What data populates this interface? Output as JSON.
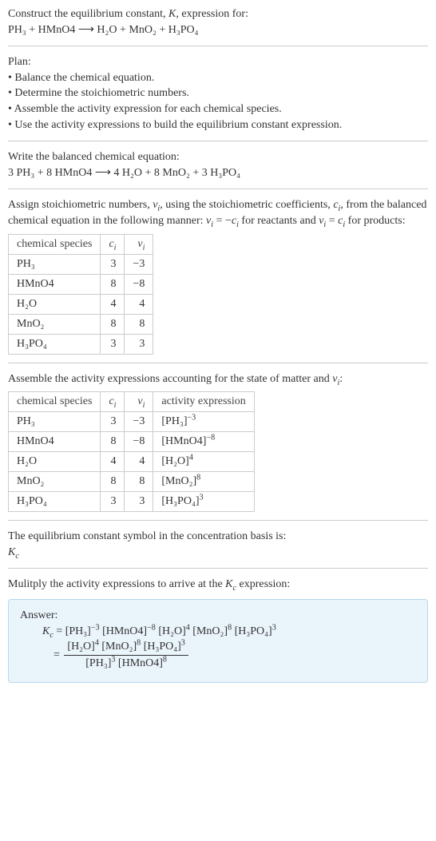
{
  "intro": {
    "line1": "Construct the equilibrium constant, K, expression for:",
    "eq": "PH₃ + HMnO4  ⟶  H₂O + MnO₂ + H₃PO₄"
  },
  "plan": {
    "heading": "Plan:",
    "items": [
      "• Balance the chemical equation.",
      "• Determine the stoichiometric numbers.",
      "• Assemble the activity expression for each chemical species.",
      "• Use the activity expressions to build the equilibrium constant expression."
    ]
  },
  "balanced": {
    "heading": "Write the balanced chemical equation:",
    "eq": "3 PH₃ + 8 HMnO4  ⟶  4 H₂O + 8 MnO₂ + 3 H₃PO₄"
  },
  "stoich_text": {
    "line": "Assign stoichiometric numbers, νᵢ, using the stoichiometric coefficients, cᵢ, from the balanced chemical equation in the following manner: νᵢ = −cᵢ for reactants and νᵢ = cᵢ for products:"
  },
  "table1": {
    "headers": [
      "chemical species",
      "cᵢ",
      "νᵢ"
    ],
    "rows": [
      {
        "s": "PH₃",
        "c": "3",
        "v": "−3"
      },
      {
        "s": "HMnO4",
        "c": "8",
        "v": "−8"
      },
      {
        "s": "H₂O",
        "c": "4",
        "v": "4"
      },
      {
        "s": "MnO₂",
        "c": "8",
        "v": "8"
      },
      {
        "s": "H₃PO₄",
        "c": "3",
        "v": "3"
      }
    ]
  },
  "activity_text": "Assemble the activity expressions accounting for the state of matter and νᵢ:",
  "table2": {
    "headers": [
      "chemical species",
      "cᵢ",
      "νᵢ",
      "activity expression"
    ],
    "rows": [
      {
        "s": "PH₃",
        "c": "3",
        "v": "−3",
        "a_base": "[PH₃]",
        "a_exp": "−3"
      },
      {
        "s": "HMnO4",
        "c": "8",
        "v": "−8",
        "a_base": "[HMnO4]",
        "a_exp": "−8"
      },
      {
        "s": "H₂O",
        "c": "4",
        "v": "4",
        "a_base": "[H₂O]",
        "a_exp": "4"
      },
      {
        "s": "MnO₂",
        "c": "8",
        "v": "8",
        "a_base": "[MnO₂]",
        "a_exp": "8"
      },
      {
        "s": "H₃PO₄",
        "c": "3",
        "v": "3",
        "a_base": "[H₃PO₄]",
        "a_exp": "3"
      }
    ]
  },
  "kc_symbol": {
    "line1": "The equilibrium constant symbol in the concentration basis is:",
    "line2": "K_c"
  },
  "multiply_text": "Mulitply the activity expressions to arrive at the K_c expression:",
  "answer": {
    "label": "Answer:",
    "line1_prefix": "K_c = ",
    "terms": [
      {
        "base": "[PH₃]",
        "exp": "−3"
      },
      {
        "base": "[HMnO4]",
        "exp": "−8"
      },
      {
        "base": "[H₂O]",
        "exp": "4"
      },
      {
        "base": "[MnO₂]",
        "exp": "8"
      },
      {
        "base": "[H₃PO₄]",
        "exp": "3"
      }
    ],
    "eq2_prefix": "= ",
    "frac_num": [
      {
        "base": "[H₂O]",
        "exp": "4"
      },
      {
        "base": "[MnO₂]",
        "exp": "8"
      },
      {
        "base": "[H₃PO₄]",
        "exp": "3"
      }
    ],
    "frac_den": [
      {
        "base": "[PH₃]",
        "exp": "3"
      },
      {
        "base": "[HMnO4]",
        "exp": "8"
      }
    ]
  },
  "chart_data": {
    "type": "table",
    "title": "Stoichiometric coefficients and numbers",
    "columns": [
      "chemical species",
      "c_i",
      "ν_i"
    ],
    "rows": [
      [
        "PH3",
        3,
        -3
      ],
      [
        "HMnO4",
        8,
        -8
      ],
      [
        "H2O",
        4,
        4
      ],
      [
        "MnO2",
        8,
        8
      ],
      [
        "H3PO4",
        3,
        3
      ]
    ]
  }
}
